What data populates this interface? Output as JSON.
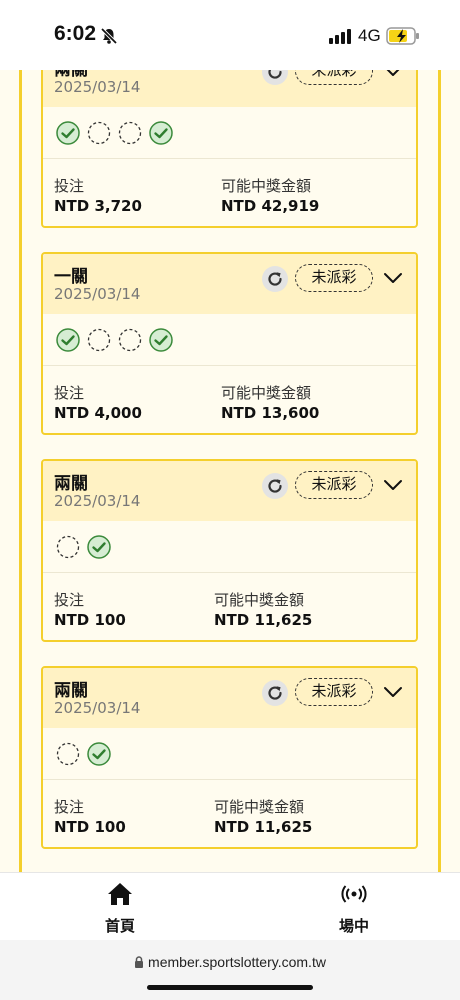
{
  "status_bar": {
    "time": "6:02",
    "network": "4G"
  },
  "cards": [
    {
      "title": "兩關",
      "date": "2025/03/14",
      "status": "未派彩",
      "legs": [
        "won",
        "pending",
        "pending",
        "won"
      ],
      "stake_label": "投注",
      "stake": "NTD 3,720",
      "payout_label": "可能中獎金額",
      "payout": "NTD 42,919"
    },
    {
      "title": "一關",
      "date": "2025/03/14",
      "status": "未派彩",
      "legs": [
        "won",
        "pending",
        "pending",
        "won"
      ],
      "stake_label": "投注",
      "stake": "NTD 4,000",
      "payout_label": "可能中獎金額",
      "payout": "NTD 13,600"
    },
    {
      "title": "兩關",
      "date": "2025/03/14",
      "status": "未派彩",
      "legs": [
        "pending",
        "won"
      ],
      "stake_label": "投注",
      "stake": "NTD 100",
      "payout_label": "可能中獎金額",
      "payout": "NTD 11,625"
    },
    {
      "title": "兩關",
      "date": "2025/03/14",
      "status": "未派彩",
      "legs": [
        "pending",
        "won"
      ],
      "stake_label": "投注",
      "stake": "NTD 100",
      "payout_label": "可能中獎金額",
      "payout": "NTD 11,625"
    }
  ],
  "bottom_nav": {
    "home_label": "首頁",
    "live_label": "場中"
  },
  "browser": {
    "url": "member.sportslottery.com.tw"
  },
  "colors": {
    "accent": "#f4cf2d",
    "header_bg": "#fff2c4",
    "won": "#4caf50"
  },
  "icons": [
    "bell-slash-icon",
    "refresh-icon",
    "chevron-down-icon",
    "check-circle-icon",
    "dashed-circle-icon",
    "home-icon",
    "broadcast-icon",
    "lock-icon"
  ]
}
